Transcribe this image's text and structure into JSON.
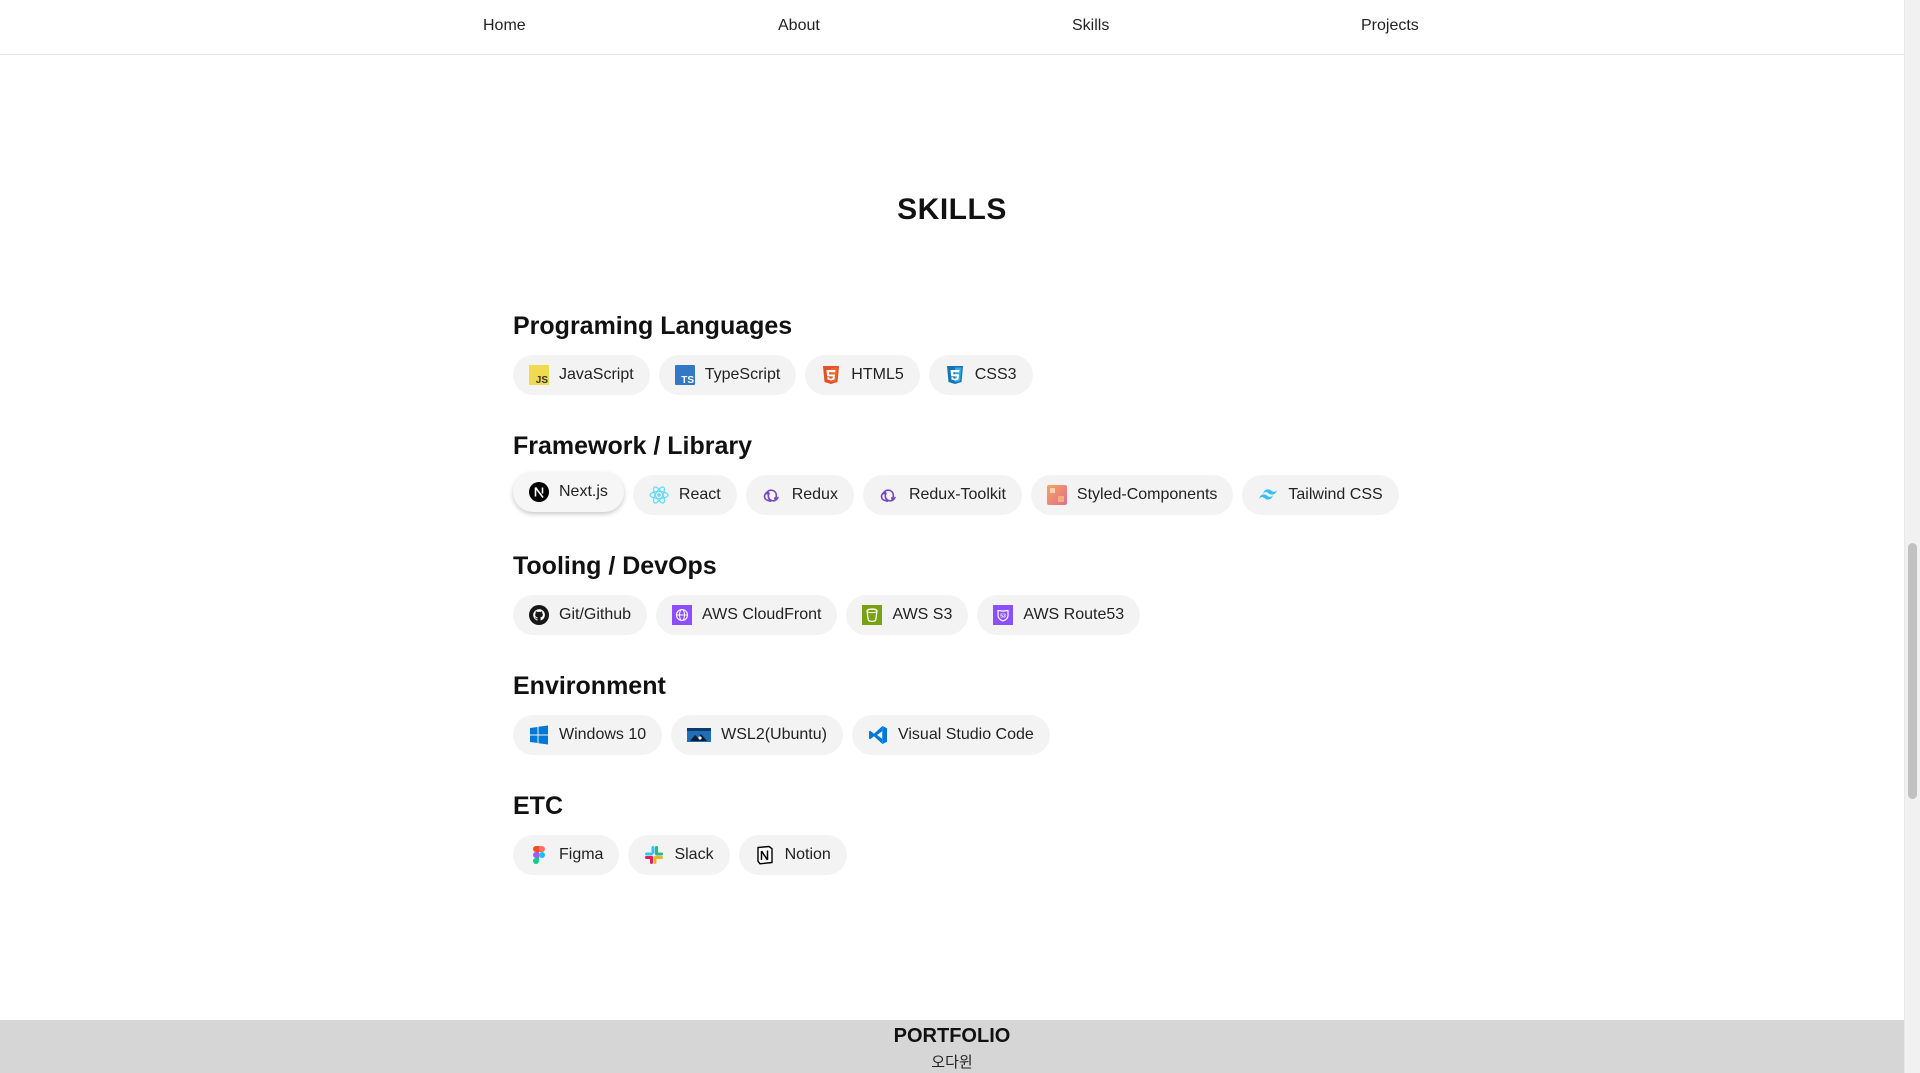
{
  "nav": {
    "items": [
      {
        "label": "Home"
      },
      {
        "label": "About"
      },
      {
        "label": "Skills"
      },
      {
        "label": "Projects"
      }
    ]
  },
  "page": {
    "title": "SKILLS"
  },
  "groups": [
    {
      "title": "Programing Languages",
      "items": [
        {
          "label": "JavaScript",
          "icon": "javascript-icon"
        },
        {
          "label": "TypeScript",
          "icon": "typescript-icon"
        },
        {
          "label": "HTML5",
          "icon": "html5-icon"
        },
        {
          "label": "CSS3",
          "icon": "css3-icon"
        }
      ]
    },
    {
      "title": "Framework / Library",
      "items": [
        {
          "label": "Next.js",
          "icon": "nextjs-icon"
        },
        {
          "label": "React",
          "icon": "react-icon"
        },
        {
          "label": "Redux",
          "icon": "redux-icon"
        },
        {
          "label": "Redux-Toolkit",
          "icon": "redux-toolkit-icon"
        },
        {
          "label": "Styled-Components",
          "icon": "styled-components-icon"
        },
        {
          "label": "Tailwind CSS",
          "icon": "tailwind-icon"
        }
      ]
    },
    {
      "title": "Tooling / DevOps",
      "items": [
        {
          "label": "Git/Github",
          "icon": "github-icon"
        },
        {
          "label": "AWS CloudFront",
          "icon": "aws-cloudfront-icon"
        },
        {
          "label": "AWS S3",
          "icon": "aws-s3-icon"
        },
        {
          "label": "AWS Route53",
          "icon": "aws-route53-icon"
        }
      ]
    },
    {
      "title": "Environment",
      "items": [
        {
          "label": "Windows 10",
          "icon": "windows-icon"
        },
        {
          "label": "WSL2(Ubuntu)",
          "icon": "wsl-icon"
        },
        {
          "label": "Visual Studio Code",
          "icon": "vscode-icon"
        }
      ]
    },
    {
      "title": "ETC",
      "items": [
        {
          "label": "Figma",
          "icon": "figma-icon"
        },
        {
          "label": "Slack",
          "icon": "slack-icon"
        },
        {
          "label": "Notion",
          "icon": "notion-icon"
        }
      ]
    }
  ],
  "footer": {
    "title": "PORTFOLIO",
    "name": "오다윈"
  },
  "colors": {
    "footer_bg": "#d6d6d6",
    "chip_bg": "#f3f3f3",
    "aws_purple": "#8c4fff",
    "aws_green": "#7aa116"
  }
}
